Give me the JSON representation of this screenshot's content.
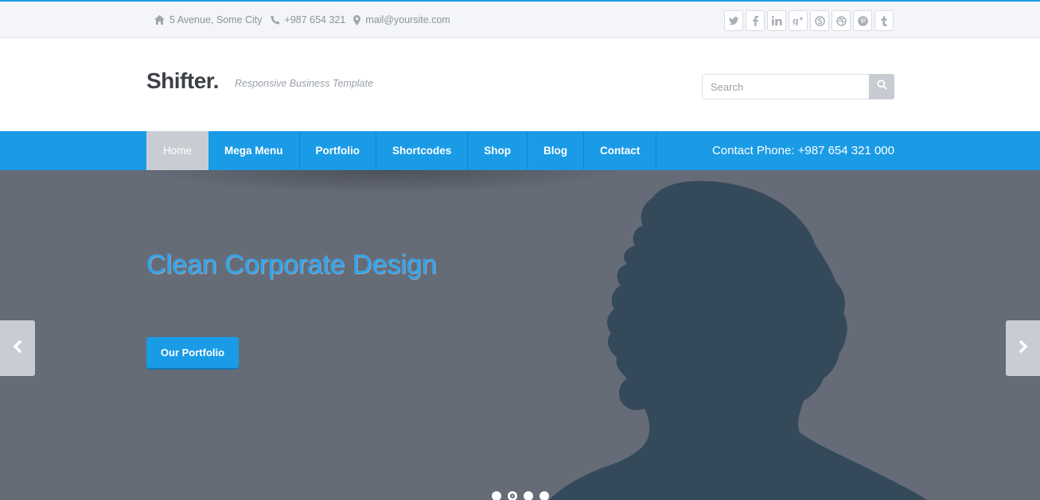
{
  "topbar": {
    "address": "5 Avenue, Some City",
    "phone": "+987 654 321",
    "email": "mail@yoursite.com",
    "social": [
      {
        "name": "twitter-icon",
        "glyph": "t"
      },
      {
        "name": "facebook-icon",
        "glyph": "f"
      },
      {
        "name": "linkedin-icon",
        "glyph": "in"
      },
      {
        "name": "google-plus-icon",
        "glyph": "g+"
      },
      {
        "name": "skype-icon",
        "glyph": "s"
      },
      {
        "name": "dribbble-icon",
        "glyph": "d"
      },
      {
        "name": "pinterest-icon",
        "glyph": "p"
      },
      {
        "name": "tumblr-icon",
        "glyph": "t"
      }
    ]
  },
  "header": {
    "logo": "Shifter.",
    "tagline": "Responsive Business Template",
    "search_placeholder": "Search"
  },
  "nav": {
    "items": [
      {
        "label": "Home",
        "active": true
      },
      {
        "label": "Mega Menu",
        "active": false
      },
      {
        "label": "Portfolio",
        "active": false
      },
      {
        "label": "Shortcodes",
        "active": false
      },
      {
        "label": "Shop",
        "active": false
      },
      {
        "label": "Blog",
        "active": false
      },
      {
        "label": "Contact",
        "active": false
      }
    ],
    "phone": "Contact Phone: +987 654 321 000"
  },
  "hero": {
    "title": "Clean Corporate Design",
    "button": "Our Portfolio",
    "slides_count": 4,
    "active_slide": 2
  },
  "colors": {
    "accent": "#1a9be6",
    "hero_bg": "#656b77",
    "silhouette": "#34495a"
  }
}
